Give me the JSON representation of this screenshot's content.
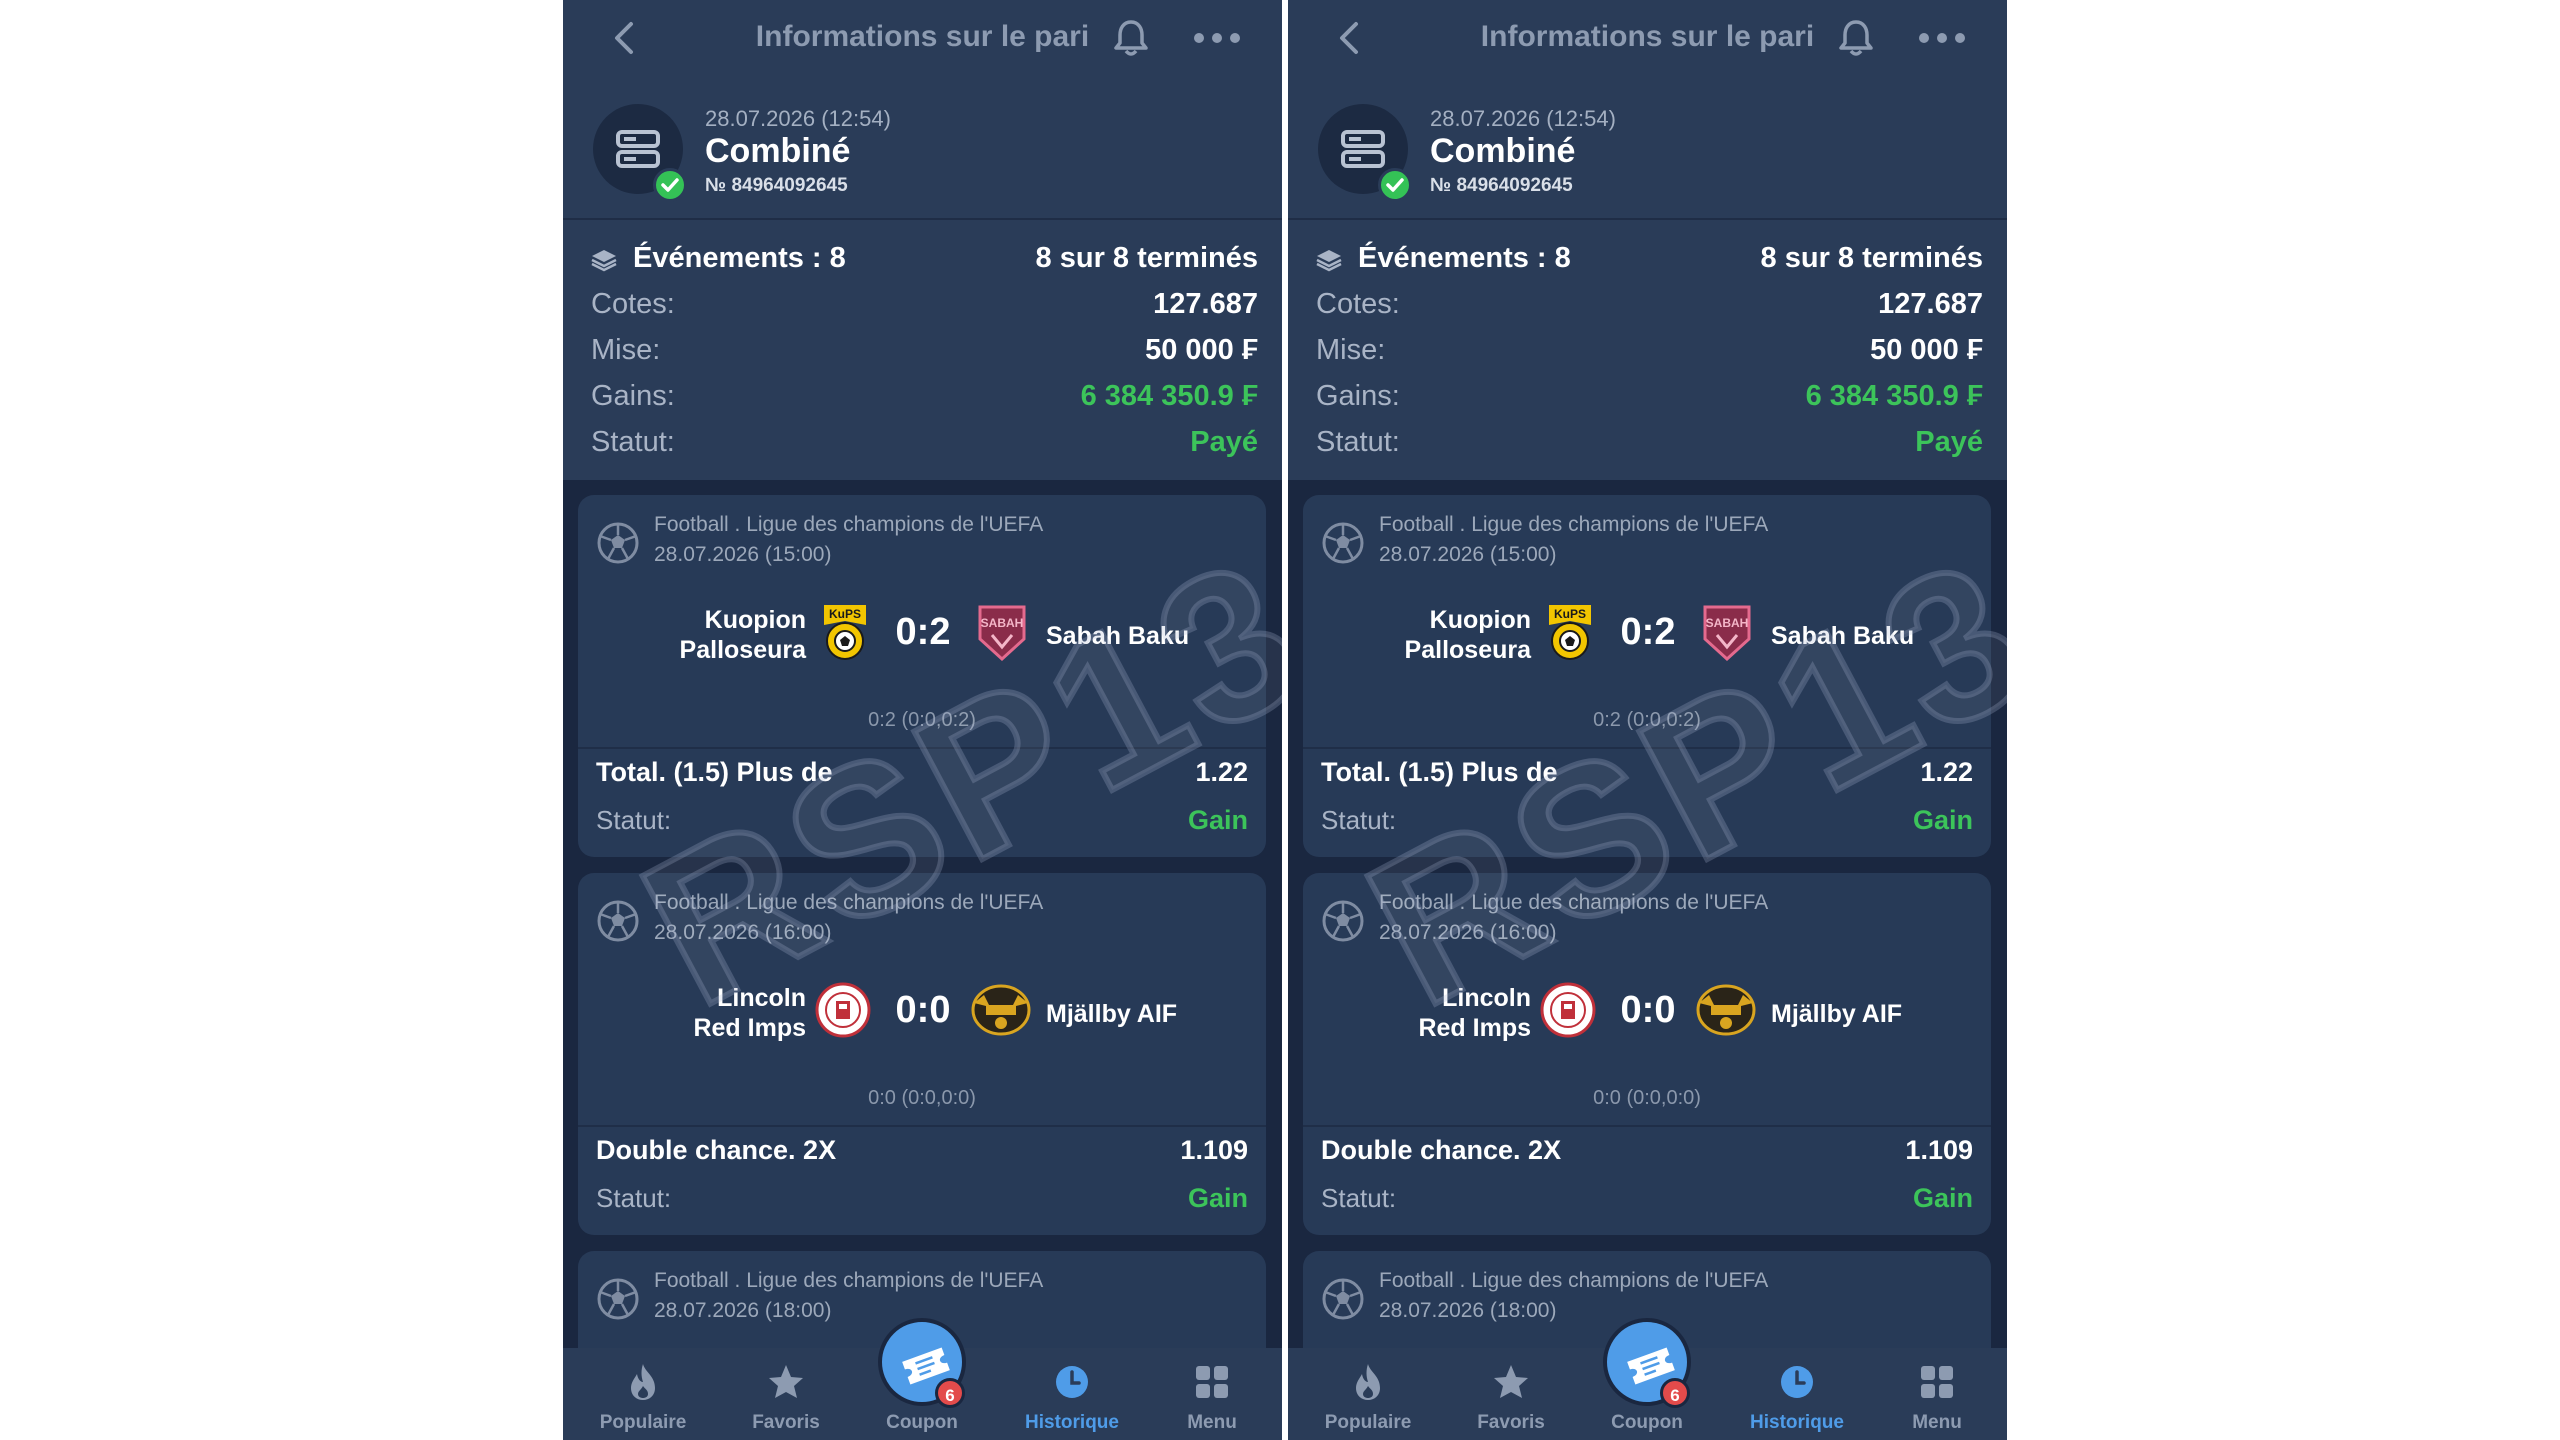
{
  "header": {
    "title": "Informations sur le pari"
  },
  "bet": {
    "date": "28.07.2026 (12:54)",
    "type": "Combiné",
    "number": "№ 84964092645",
    "events_label": "Événements : 8",
    "events_done": "8 sur 8 terminés",
    "rows": [
      {
        "label": "Cotes:",
        "value": "127.687"
      },
      {
        "label": "Mise:",
        "value": "50 000 ₣"
      },
      {
        "label": "Gains:",
        "value": "6 384 350.9 ₣"
      },
      {
        "label": "Statut:",
        "value": "Payé"
      }
    ]
  },
  "events": [
    {
      "league": "Football . Ligue des champions de l'UEFA",
      "date": "28.07.2026 (15:00)",
      "team1_line1": "Kuopion",
      "team1_line2": "Palloseura",
      "team1_logo_text": "KuPS",
      "team2": "Sabah Baku",
      "team2_logo_text": "SABAH",
      "score": "0:2",
      "subscore": "0:2 (0:0,0:2)",
      "market": "Total. (1.5) Plus de",
      "odd": "1.22",
      "status_label": "Statut:",
      "status": "Gain"
    },
    {
      "league": "Football . Ligue des champions de l'UEFA",
      "date": "28.07.2026 (16:00)",
      "team1_line1": "Lincoln",
      "team1_line2": "Red Imps",
      "team2": "Mjällby AIF",
      "score": "0:0",
      "subscore": "0:0 (0:0,0:0)",
      "market": "Double chance. 2X",
      "odd": "1.109",
      "status_label": "Statut:",
      "status": "Gain"
    },
    {
      "league": "Football . Ligue des champions de l'UEFA",
      "date": "28.07.2026 (18:00)"
    }
  ],
  "watermark": "RSP13",
  "tabs": [
    {
      "label": "Populaire",
      "icon": "flame-icon"
    },
    {
      "label": "Favoris",
      "icon": "star-icon"
    },
    {
      "label": "Coupon",
      "icon": "ticket-icon"
    },
    {
      "label": "Historique",
      "icon": "clock-icon"
    },
    {
      "label": "Menu",
      "icon": "grid-icon"
    }
  ],
  "coupon_badge": "6",
  "colors": {
    "background": "#1a2740",
    "panel": "#2a3c58",
    "card": "#273a57",
    "accent": "#4f9ce8",
    "success": "#3cc45a",
    "badge": "#e34b4b"
  }
}
